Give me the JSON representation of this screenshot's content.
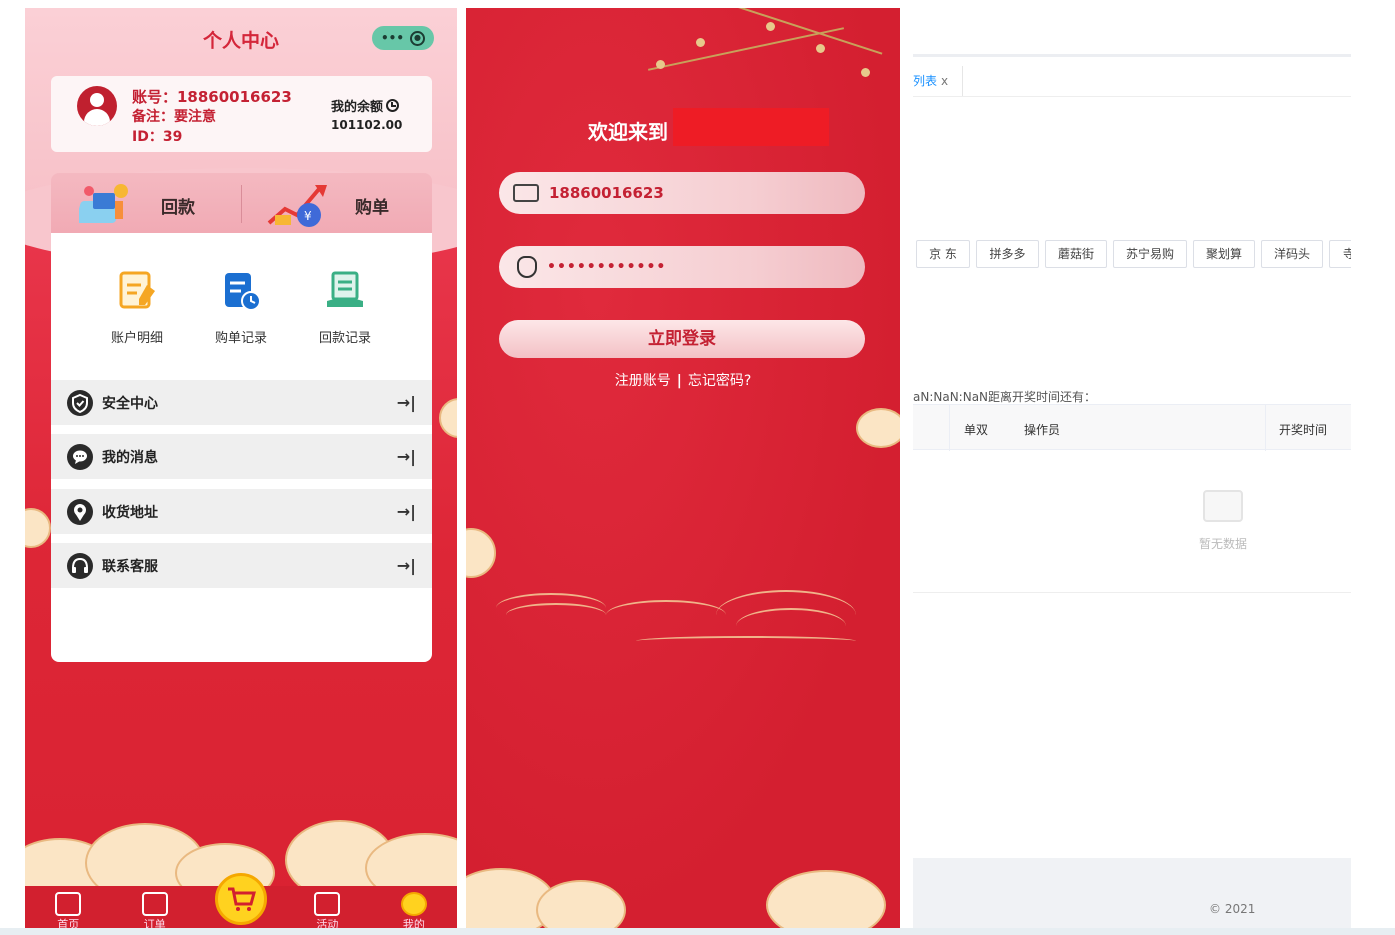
{
  "profile": {
    "title": "个人中心",
    "account_label": "账号：18860016623",
    "remark_label": "备注：要注意",
    "id_label": "ID：39",
    "balance_label": "我的余额",
    "balance_value": "101102.00",
    "quick": [
      {
        "label": "回款"
      },
      {
        "label": "购单"
      }
    ],
    "grid": [
      {
        "label": "账户明细"
      },
      {
        "label": "购单记录"
      },
      {
        "label": "回款记录"
      }
    ],
    "menu": [
      {
        "label": "安全中心"
      },
      {
        "label": "我的消息"
      },
      {
        "label": "收货地址"
      },
      {
        "label": "联系客服"
      }
    ],
    "tabs": [
      {
        "label": "首页"
      },
      {
        "label": "订单"
      },
      {
        "label": ""
      },
      {
        "label": "活动"
      },
      {
        "label": "我的"
      }
    ],
    "colors": {
      "accent": "#d4263a",
      "tabbar": "#d2202f",
      "cart": "#ffd21f"
    }
  },
  "login": {
    "welcome": "欢迎来到",
    "username_value": "18860016623",
    "password_value": "••••••••••••",
    "submit_label": "立即登录",
    "register_label": "注册账号",
    "separator": "|",
    "forgot_label": "忘记密码?"
  },
  "admin": {
    "tab_label": "列表",
    "tab_close": "x",
    "platforms": [
      "京 东",
      "拼多多",
      "蘑菇街",
      "苏宁易购",
      "聚划算",
      "洋码头",
      "寺"
    ],
    "countdown_text": "aN:NaN:NaN距离开奖时间还有：",
    "columns": [
      "单双",
      "操作员",
      "开奖时间"
    ],
    "empty_text": "暂无数据",
    "copyright": "© 2021"
  }
}
